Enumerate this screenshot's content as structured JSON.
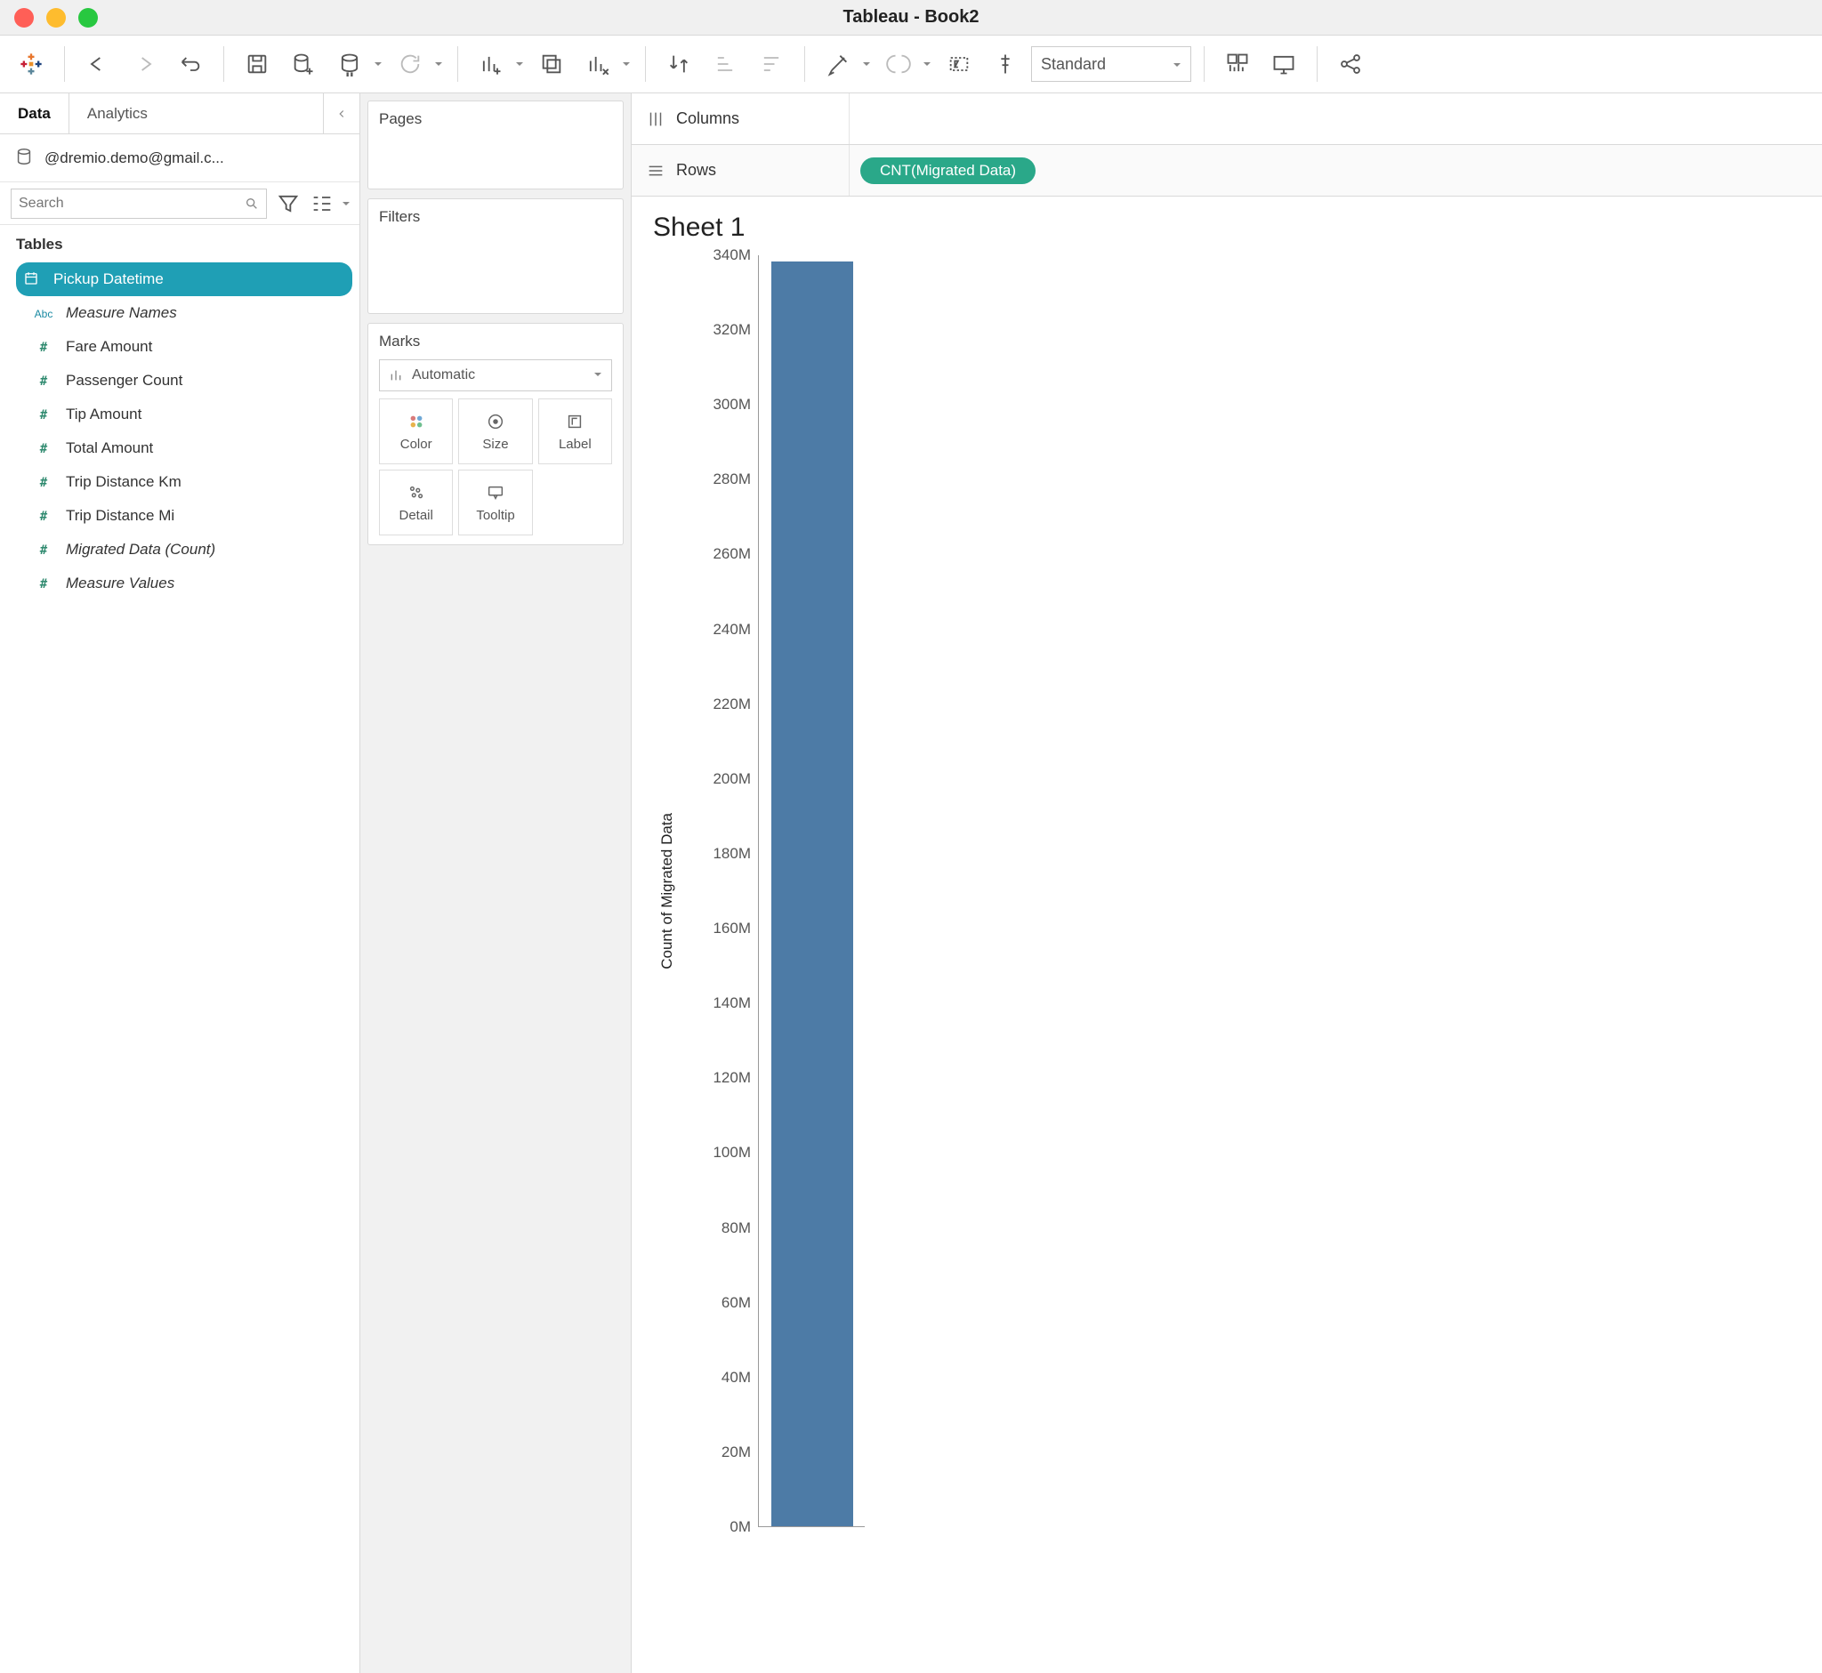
{
  "window": {
    "title": "Tableau - Book2"
  },
  "side_tabs": {
    "data": "Data",
    "analytics": "Analytics"
  },
  "datasource": {
    "label": "@dremio.demo@gmail.c..."
  },
  "search": {
    "placeholder": "Search"
  },
  "tables_header": "Tables",
  "fields": [
    {
      "icon": "calendar",
      "label": "Pickup Datetime",
      "color": "blue",
      "active": true,
      "italic": false
    },
    {
      "icon": "abc",
      "label": "Measure Names",
      "color": "blue",
      "active": false,
      "italic": true
    },
    {
      "icon": "hash",
      "label": "Fare Amount",
      "color": "green",
      "active": false,
      "italic": false
    },
    {
      "icon": "hash",
      "label": "Passenger Count",
      "color": "green",
      "active": false,
      "italic": false
    },
    {
      "icon": "hash",
      "label": "Tip Amount",
      "color": "green",
      "active": false,
      "italic": false
    },
    {
      "icon": "hash",
      "label": "Total Amount",
      "color": "green",
      "active": false,
      "italic": false
    },
    {
      "icon": "hash",
      "label": "Trip Distance Km",
      "color": "green",
      "active": false,
      "italic": false
    },
    {
      "icon": "hash",
      "label": "Trip Distance Mi",
      "color": "green",
      "active": false,
      "italic": false
    },
    {
      "icon": "hash",
      "label": "Migrated Data (Count)",
      "color": "green",
      "active": false,
      "italic": true
    },
    {
      "icon": "hash",
      "label": "Measure Values",
      "color": "green",
      "active": false,
      "italic": true
    }
  ],
  "cards": {
    "pages": "Pages",
    "filters": "Filters",
    "marks": "Marks",
    "mark_type": "Automatic",
    "cells": {
      "color": "Color",
      "size": "Size",
      "label": "Label",
      "detail": "Detail",
      "tooltip": "Tooltip"
    }
  },
  "shelves": {
    "columns": "Columns",
    "rows": "Rows",
    "row_pill": "CNT(Migrated Data)"
  },
  "fit_mode": "Standard",
  "sheet": {
    "title": "Sheet 1"
  },
  "chart_data": {
    "type": "bar",
    "categories": [
      ""
    ],
    "values": [
      338000000
    ],
    "title": "Sheet 1",
    "xlabel": "",
    "ylabel": "Count of Migrated Data",
    "ylim": [
      0,
      340000000
    ],
    "yticks": [
      0,
      20,
      40,
      60,
      80,
      100,
      120,
      140,
      160,
      180,
      200,
      220,
      240,
      260,
      280,
      300,
      320,
      340
    ],
    "ytick_suffix": "M",
    "bar_color": "#4d7ba6"
  }
}
